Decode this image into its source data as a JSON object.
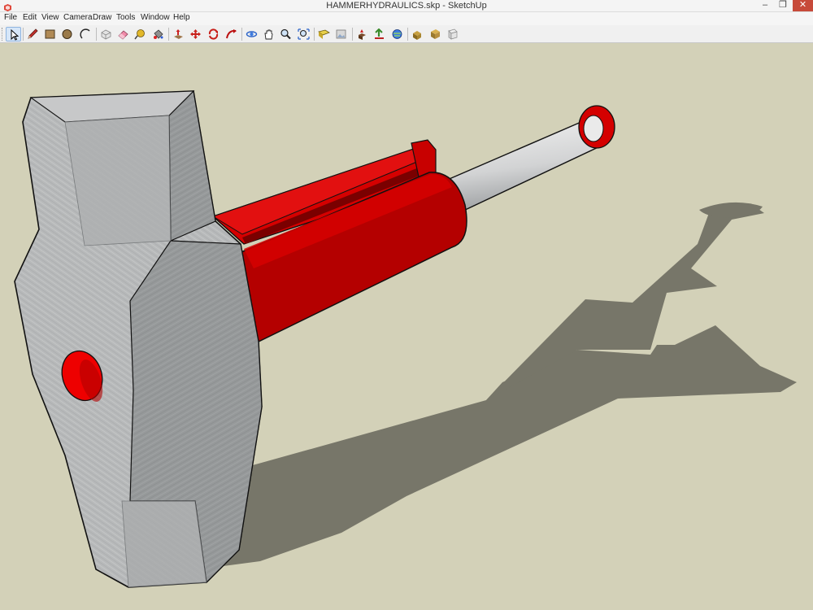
{
  "window": {
    "title": "HAMMERHYDRAULICS.skp - SketchUp",
    "icon": "sketchup-logo-icon",
    "controls": {
      "minimize": "‒",
      "maximize": "❐",
      "close": "✕"
    }
  },
  "menu": [
    "File",
    "Edit",
    "View",
    "Camera",
    "Draw",
    "Tools",
    "Window",
    "Help"
  ],
  "toolbar": {
    "tools": [
      "select-icon",
      "pencil-icon",
      "rectangle-icon",
      "circle-icon",
      "arc-icon",
      "make-component-icon",
      "eraser-icon",
      "tape-measure-icon",
      "paint-bucket-icon",
      "push-pull-icon",
      "move-icon",
      "rotate-icon",
      "follow-me-icon",
      "orbit-icon",
      "pan-icon",
      "zoom-icon",
      "zoom-extents-icon",
      "add-location-icon",
      "photo-textures-icon",
      "get-models-icon",
      "share-model-icon",
      "3d-warehouse-icon",
      "component-warehouse-icon",
      "extension-icon",
      "layout-icon"
    ],
    "active_tool": "select-icon"
  },
  "colors": {
    "background": "#d3d1b8",
    "shadow": "#77766a",
    "metal_light": "#bfc1c1",
    "metal_dark": "#8f9293",
    "cylinder_red": "#d80000",
    "cylinder_dark": "#a20000",
    "rod": "#e9eaea"
  }
}
